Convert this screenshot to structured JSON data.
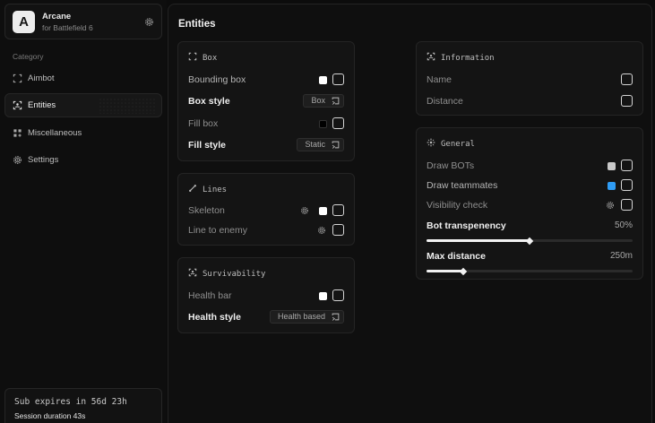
{
  "brand": {
    "logo_letter": "A",
    "name": "Arcane",
    "subtitle": "for Battlefield 6"
  },
  "sidebar": {
    "category_label": "Category",
    "items": [
      {
        "label": "Aimbot",
        "icon": "target-frame-icon"
      },
      {
        "label": "Entities",
        "icon": "entity-icon",
        "active": true
      },
      {
        "label": "Miscellaneous",
        "icon": "grid-icon"
      },
      {
        "label": "Settings",
        "icon": "gear-icon"
      }
    ]
  },
  "subscription": {
    "expires": "Sub expires in 56d 23h",
    "session": "Session duration 43s"
  },
  "page": {
    "title": "Entities"
  },
  "box_panel": {
    "title": "Box",
    "bounding_box": {
      "label": "Bounding box",
      "color": "#ffffff",
      "checked": false
    },
    "box_style": {
      "label": "Box style",
      "value": "Box"
    },
    "fill_box": {
      "label": "Fill box",
      "color": "#000000",
      "checked": false
    },
    "fill_style": {
      "label": "Fill style",
      "value": "Static"
    }
  },
  "lines_panel": {
    "title": "Lines",
    "skeleton": {
      "label": "Skeleton",
      "color": "#ffffff",
      "checked": false
    },
    "line_to_enemy": {
      "label": "Line to enemy",
      "checked": false
    }
  },
  "surv_panel": {
    "title": "Survivability",
    "health_bar": {
      "label": "Health bar",
      "color": "#ffffff",
      "checked": false
    },
    "health_style": {
      "label": "Health style",
      "value": "Health based"
    }
  },
  "info_panel": {
    "title": "Information",
    "name": {
      "label": "Name",
      "checked": false
    },
    "distance": {
      "label": "Distance",
      "checked": false
    }
  },
  "general_panel": {
    "title": "General",
    "draw_bots": {
      "label": "Draw BOTs",
      "color": "#c9c9c9",
      "checked": false
    },
    "draw_teammates": {
      "label": "Draw teammates",
      "color": "#2f9cf4",
      "checked": false
    },
    "visibility_check": {
      "label": "Visibility check",
      "checked": false
    },
    "bot_transparency": {
      "label": "Bot transpenency",
      "value_text": "50%",
      "fraction": 0.5
    },
    "max_distance": {
      "label": "Max distance",
      "value_text": "250m",
      "fraction": 0.18
    }
  }
}
